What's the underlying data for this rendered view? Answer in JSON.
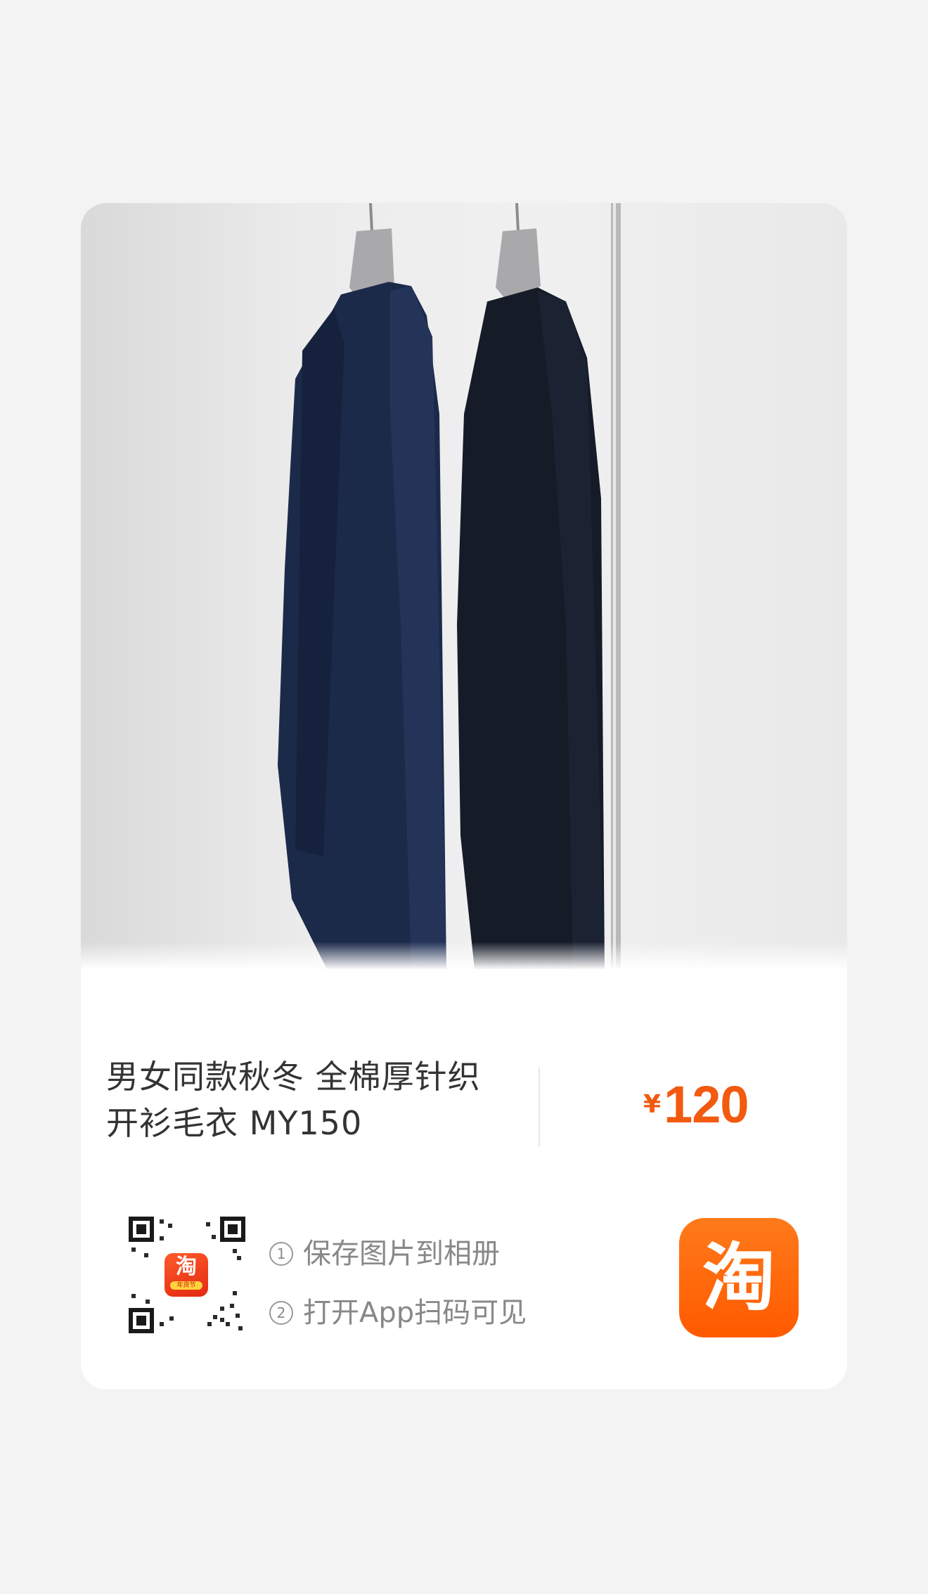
{
  "product": {
    "title_line1": "男女同款秋冬 全棉厚针织",
    "title_line2": "开衫毛衣 MY150",
    "price_currency": "¥",
    "price_value": "120",
    "image_icon": "product-photo-cardigans-on-hangers"
  },
  "share": {
    "step1_num": "①",
    "step1_text": "保存图片到相册",
    "step2_num": "②",
    "step2_text": "打开App扫码可见",
    "qr_logo_glyph": "淘",
    "qr_logo_sub": "年货节",
    "app_icon_glyph": "淘"
  },
  "colors": {
    "price": "#f25a0f",
    "app_icon": "#ff6a00",
    "title_text": "#333333",
    "step_text": "#888888"
  }
}
